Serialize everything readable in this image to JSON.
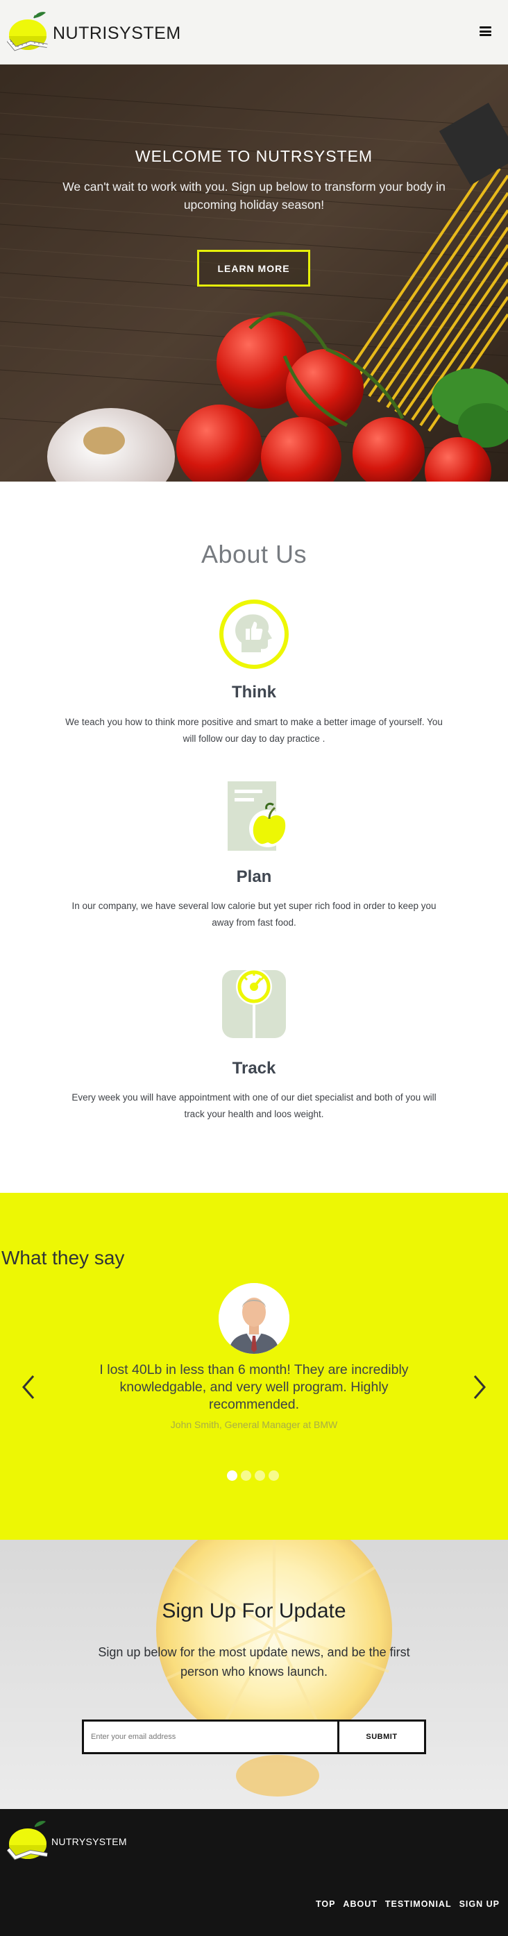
{
  "header": {
    "brand_name": "NUTRISYSTEM",
    "logo_icon": "lemon-scale-logo-icon",
    "menu_icon": "hamburger-menu-icon"
  },
  "hero": {
    "title": "WELCOME TO NUTRSYSTEM",
    "subtitle": "We can't wait to work with you. Sign up below to transform your body in upcoming holiday season!",
    "button_label": "LEARN MORE"
  },
  "about": {
    "title": "About Us",
    "features": [
      {
        "icon": "thumbs-up-head-icon",
        "title": "Think",
        "text": "We teach you how to think more positive and smart to make a better image of yourself. You will follow our day to day practice ."
      },
      {
        "icon": "plan-apple-icon",
        "title": "Plan",
        "text": "In our company, we have several low calorie but yet super rich food in order to keep you away from fast food."
      },
      {
        "icon": "weight-scale-icon",
        "title": "Track",
        "text": "Every week you will have appointment with one of our diet specialist and both of you will track your health and loos weight."
      }
    ]
  },
  "testimonials": {
    "heading": "What they say",
    "quote": "I lost 40Lb in less than 6 month! They are incredibly knowledgable, and very well program. Highly recommended.",
    "author": "John Smith, General Manager at BMW",
    "avatar_icon": "person-avatar-icon",
    "prev_icon": "chevron-left-icon",
    "next_icon": "chevron-right-icon",
    "slide_count": 4,
    "active_slide": 1
  },
  "signup": {
    "title": "Sign Up For Update",
    "subtitle": "Sign up below for the most update news, and be the first person who knows launch.",
    "email_placeholder": "Enter your email address",
    "email_value": "",
    "submit_label": "SUBMIT"
  },
  "footer": {
    "brand_name": "NUTRYSYSTEM",
    "nav": [
      "TOP",
      "ABOUT",
      "TESTIMONIAL",
      "SIGN UP"
    ]
  },
  "colors": {
    "accent": "#edf704",
    "dark": "#141414",
    "icon_green": "#d8e2d0"
  }
}
